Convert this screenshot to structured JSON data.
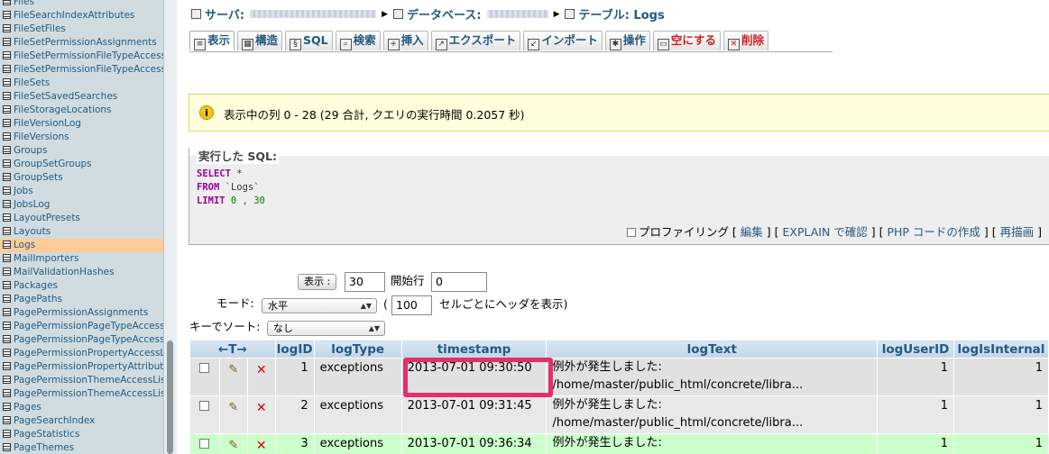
{
  "sidebar": {
    "items": [
      {
        "label": "Files"
      },
      {
        "label": "FileSearchIndexAttributes"
      },
      {
        "label": "FileSetFiles"
      },
      {
        "label": "FileSetPermissionAssignments"
      },
      {
        "label": "FileSetPermissionFileTypeAccessl"
      },
      {
        "label": "FileSetPermissionFileTypeAccessl"
      },
      {
        "label": "FileSets"
      },
      {
        "label": "FileSetSavedSearches"
      },
      {
        "label": "FileStorageLocations"
      },
      {
        "label": "FileVersionLog"
      },
      {
        "label": "FileVersions"
      },
      {
        "label": "Groups"
      },
      {
        "label": "GroupSetGroups"
      },
      {
        "label": "GroupSets"
      },
      {
        "label": "Jobs"
      },
      {
        "label": "JobsLog"
      },
      {
        "label": "LayoutPresets"
      },
      {
        "label": "Layouts"
      },
      {
        "label": "Logs",
        "active": true
      },
      {
        "label": "MailImporters"
      },
      {
        "label": "MailValidationHashes"
      },
      {
        "label": "Packages"
      },
      {
        "label": "PagePaths"
      },
      {
        "label": "PagePermissionAssignments"
      },
      {
        "label": "PagePermissionPageTypeAccess"
      },
      {
        "label": "PagePermissionPageTypeAccess"
      },
      {
        "label": "PagePermissionPropertyAccessL"
      },
      {
        "label": "PagePermissionPropertyAttribute"
      },
      {
        "label": "PagePermissionThemeAccessList"
      },
      {
        "label": "PagePermissionThemeAccessList"
      },
      {
        "label": "Pages"
      },
      {
        "label": "PageSearchIndex"
      },
      {
        "label": "PageStatistics"
      },
      {
        "label": "PageThemes"
      }
    ]
  },
  "breadcrumb": {
    "server_label": "サーバ:",
    "database_label": "データベース:",
    "table_label": "テーブル: Logs"
  },
  "tabs": [
    {
      "label": "表示",
      "icon": "browse-icon",
      "active": true
    },
    {
      "label": "構造",
      "icon": "structure-icon"
    },
    {
      "label": "SQL",
      "icon": "sql-icon"
    },
    {
      "label": "検索",
      "icon": "search-icon"
    },
    {
      "label": "挿入",
      "icon": "insert-icon"
    },
    {
      "label": "エクスポート",
      "icon": "export-icon"
    },
    {
      "label": "インポート",
      "icon": "import-icon"
    },
    {
      "label": "操作",
      "icon": "operations-icon"
    },
    {
      "label": "空にする",
      "icon": "empty-icon",
      "danger": true
    },
    {
      "label": "削除",
      "icon": "drop-icon",
      "danger": true
    }
  ],
  "notice": {
    "message": "表示中の列 0 - 28 (29 合計, クエリの実行時間 0.2057 秒)"
  },
  "sql": {
    "legend": "実行した SQL:",
    "select_kw": "SELECT",
    "select_rest": " *",
    "from_kw": "FROM",
    "from_rest": " `Logs`",
    "limit_kw": "LIMIT",
    "limit_rest": " 0 , 30",
    "profiling_label": "プロファイリング",
    "edit_link": "編集",
    "explain_link": "EXPLAIN で確認",
    "php_link": "PHP コードの作成",
    "refresh_link": "再描画"
  },
  "controls": {
    "show_button": "表示 :",
    "rows_value": "30",
    "start_label": "開始行",
    "start_value": "0",
    "mode_label": "モード:",
    "mode_value": "水平",
    "paren_open": "(",
    "repeat_value": "100",
    "repeat_suffix": "セルごとにヘッダを表示)",
    "sort_label": "キーでソート:",
    "sort_value": "なし"
  },
  "table": {
    "header_arrows": "←T→",
    "columns": [
      "logID",
      "logType",
      "timestamp",
      "logText",
      "logUserID",
      "logIsInternal"
    ],
    "rows": [
      {
        "logID": "1",
        "logType": "exceptions",
        "timestamp": "2013-07-01 09:30:50",
        "logText_1": "例外が発生しました:",
        "logText_2": "/home/master/public_html/concrete/libra...",
        "logUserID": "1",
        "logIsInternal": "1"
      },
      {
        "logID": "2",
        "logType": "exceptions",
        "timestamp": "2013-07-01 09:31:45",
        "logText_1": "例外が発生しました:",
        "logText_2": "/home/master/public_html/concrete/libra...",
        "logUserID": "1",
        "logIsInternal": "1"
      },
      {
        "logID": "3",
        "logType": "exceptions",
        "timestamp": "2013-07-01 09:36:34",
        "logText_1": "例外が発生しました:",
        "logText_2": "",
        "logUserID": "1",
        "logIsInternal": "1"
      }
    ]
  },
  "colors": {
    "link": "#235a81",
    "highlight": "#e33069",
    "active_nav": "#ffcc99",
    "notice_bg": "#ffffdd"
  }
}
